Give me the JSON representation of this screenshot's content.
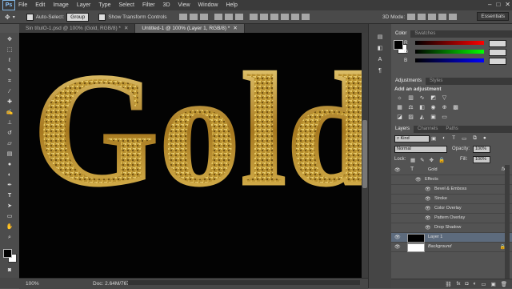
{
  "app": {
    "logo": "Ps"
  },
  "menu": [
    "File",
    "Edit",
    "Image",
    "Layer",
    "Type",
    "Select",
    "Filter",
    "3D",
    "View",
    "Window",
    "Help"
  ],
  "window_controls": {
    "minimize": "–",
    "restore": "□",
    "close": "✕"
  },
  "options_bar": {
    "auto_select_label": "Auto-Select:",
    "auto_select_value": "Group",
    "show_transform_label": "Show Transform Controls",
    "mode_3d_label": "3D Mode:",
    "workspace": "Essentials"
  },
  "tabs": [
    {
      "label": "Sin títulO-1.psd @ 100% (Gold, RGB/8) *",
      "close": "✕",
      "active": false
    },
    {
      "label": "Untitled-1 @ 100% (Layer 1, RGB/8) *",
      "close": "✕",
      "active": true
    }
  ],
  "canvas": {
    "text": "Gold",
    "background": "#030303",
    "text_color": "#c9a13a"
  },
  "status": {
    "zoom": "100%",
    "doc": "Doc: 2.64M/767.6K"
  },
  "color_panel": {
    "tabs": [
      "Color",
      "Swatches"
    ],
    "channels": [
      {
        "label": "R",
        "value": ""
      },
      {
        "label": "G",
        "value": ""
      },
      {
        "label": "B",
        "value": ""
      }
    ],
    "foreground": "#000000",
    "background": "#ffffff"
  },
  "adjustments_panel": {
    "tabs": [
      "Adjustments",
      "Styles"
    ],
    "heading": "Add an adjustment"
  },
  "layers_panel": {
    "tabs": [
      "Layers",
      "Channels",
      "Paths"
    ],
    "kind_label": "Kind",
    "blend_mode": "Normal",
    "opacity_label": "Opacity:",
    "opacity_value": "100%",
    "lock_label": "Lock:",
    "fill_label": "Fill:",
    "fill_value": "100%",
    "layers": [
      {
        "name": "Gold",
        "type": "text",
        "fx": "fx"
      },
      {
        "name": "Effects",
        "type": "effects-header"
      },
      {
        "name": "Bevel & Emboss",
        "type": "effect"
      },
      {
        "name": "Stroke",
        "type": "effect"
      },
      {
        "name": "Color Overlay",
        "type": "effect"
      },
      {
        "name": "Pattern Overlay",
        "type": "effect"
      },
      {
        "name": "Drop Shadow",
        "type": "effect"
      },
      {
        "name": "Layer 1",
        "type": "pixel",
        "selected": true
      },
      {
        "name": "Background",
        "type": "background",
        "italic": true
      }
    ]
  }
}
